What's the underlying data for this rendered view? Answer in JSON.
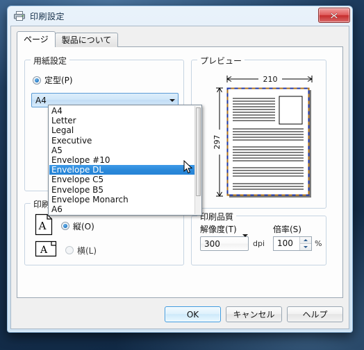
{
  "window": {
    "title": "印刷設定",
    "icon": "printer-icon",
    "close_label": "x"
  },
  "tabs": [
    {
      "label": "ページ",
      "active": true
    },
    {
      "label": "製品について",
      "active": false
    }
  ],
  "paper_group": {
    "legend": "用紙設定",
    "radio_label": "定型(P)",
    "radio_checked": true,
    "combo_value": "A4",
    "options": [
      "A4",
      "Letter",
      "Legal",
      "Executive",
      "A5",
      "Envelope #10",
      "Envelope DL",
      "Envelope C5",
      "Envelope B5",
      "Envelope Monarch",
      "A6"
    ],
    "highlighted_option": "Envelope DL",
    "highlighted_index": 6
  },
  "preview_group": {
    "legend": "プレビュー",
    "width_mm": "210",
    "height_mm": "297",
    "page_border_colors": [
      "#1b36a8",
      "#b37316"
    ]
  },
  "orientation_group": {
    "legend": "印刷方向",
    "portrait": {
      "label": "縦(O)",
      "checked": true,
      "icon_letter": "A"
    },
    "landscape": {
      "label": "横(L)",
      "checked": false,
      "icon_letter": "A"
    }
  },
  "quality_group": {
    "legend": "印刷品質",
    "resolution_label": "解像度(T)",
    "resolution_value": "300",
    "resolution_unit": "dpi",
    "scale_label": "倍率(S)",
    "scale_value": "100",
    "scale_unit": "%"
  },
  "buttons": {
    "ok": "OK",
    "cancel": "キャンセル",
    "help": "ヘルプ"
  },
  "colors": {
    "accent": "#2b8ada",
    "dialog_bg": "#f0f0f0",
    "page_bg": "#fdfdfd",
    "close_red": "#c62c2c"
  }
}
